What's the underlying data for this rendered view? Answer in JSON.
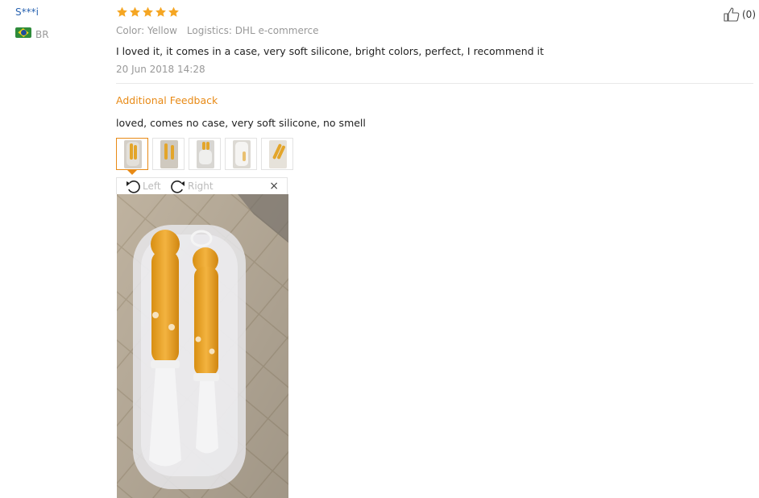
{
  "reviewer": {
    "name": "S***i",
    "country": "BR",
    "flag": "brazil-flag-icon"
  },
  "rating": {
    "stars": 5,
    "max": 5,
    "color": "#f5a623"
  },
  "helpful": {
    "count_label": "(0)",
    "icon": "thumbs-up-icon"
  },
  "meta": {
    "color": "Color: Yellow",
    "logistics": "Logistics: DHL e-commerce"
  },
  "review": {
    "text": "I loved it, it comes in a case, very soft silicone, bright colors, perfect, I recommend it",
    "date": "20 Jun 2018 14:28"
  },
  "additional": {
    "title": "Additional Feedback",
    "text": "loved, comes no case, very soft silicone, no smell"
  },
  "thumbnails": [
    {
      "name": "photo-1",
      "active": true
    },
    {
      "name": "photo-2",
      "active": false
    },
    {
      "name": "photo-3",
      "active": false
    },
    {
      "name": "photo-4",
      "active": false
    },
    {
      "name": "photo-5",
      "active": false
    }
  ],
  "viewer": {
    "rotate_left": "Left",
    "rotate_right": "Right",
    "close_icon": "×"
  },
  "colors": {
    "link": "#2a64b1",
    "accent": "#e88a16",
    "muted": "#999999"
  }
}
